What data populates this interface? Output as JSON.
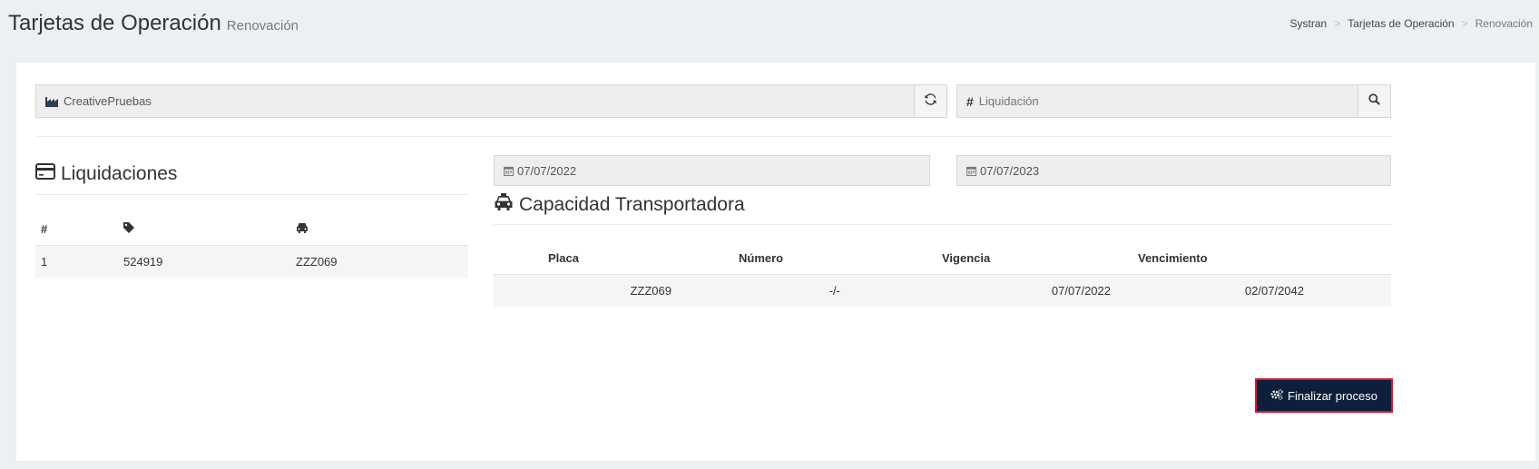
{
  "header": {
    "title": "Tarjetas de Operación",
    "subtitle": "Renovación"
  },
  "breadcrumb": {
    "item1": "Systran",
    "item2": "Tarjetas de Operación",
    "item3": "Renovación",
    "separator": ">"
  },
  "company": {
    "value": "CreativePruebas",
    "icon": "industry-icon",
    "refresh_icon": "refresh-icon"
  },
  "liquidacion_search": {
    "placeholder": "Liquidación",
    "icon": "hash-icon",
    "search_icon": "search-icon"
  },
  "dates": {
    "start": "07/07/2022",
    "end": "07/07/2023",
    "icon": "calendar-icon"
  },
  "liquidaciones": {
    "title": "Liquidaciones",
    "icon": "credit-card-icon",
    "columns": [
      "#",
      "tag-icon",
      "car-icon"
    ],
    "rows": [
      {
        "num": "1",
        "liquidacion": "524919",
        "placa": "ZZZ069"
      }
    ]
  },
  "capacidad": {
    "title": "Capacidad Transportadora",
    "icon": "taxi-icon",
    "columns": [
      "Placa",
      "Número",
      "Vigencia",
      "Vencimiento"
    ],
    "rows": [
      {
        "placa": "ZZZ069",
        "numero": "-/-",
        "vigencia": "07/07/2022",
        "vencimiento": "02/07/2042"
      }
    ]
  },
  "actions": {
    "finalize_label": "Finalizar proceso",
    "finalize_icon": "gears-icon"
  },
  "colors": {
    "page_bg": "#ecf0f5",
    "button_bg": "#0d1f3a",
    "button_border": "#e0142e",
    "stripe": "#f5f5f5"
  }
}
